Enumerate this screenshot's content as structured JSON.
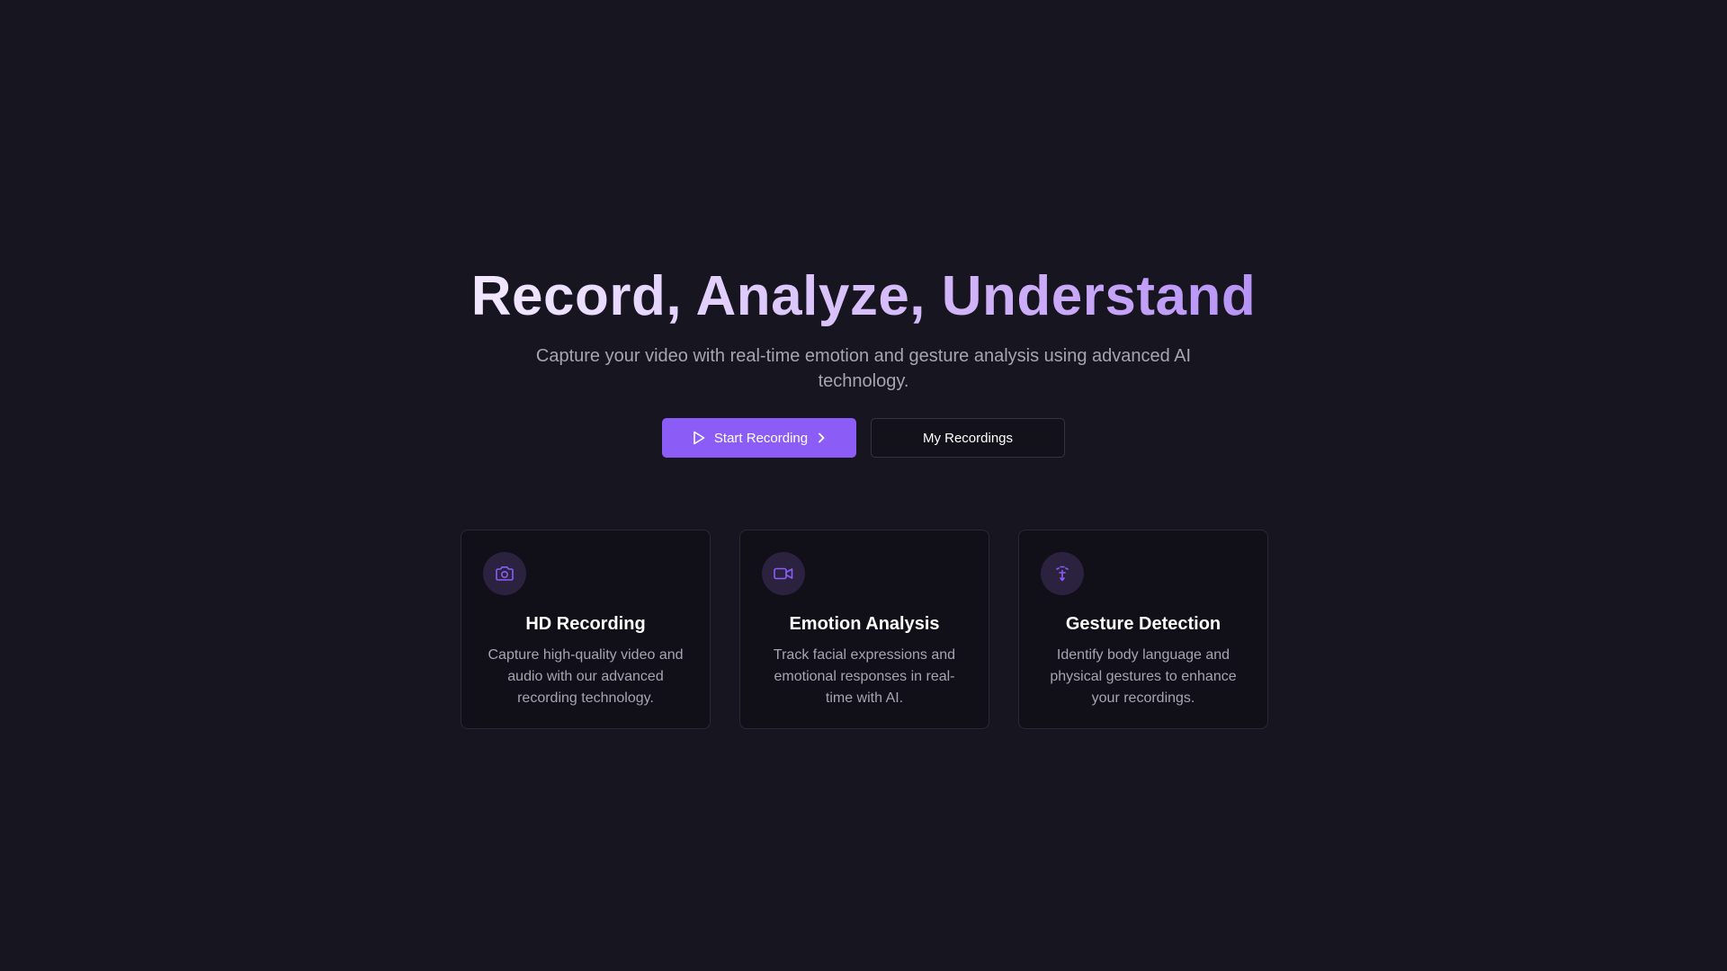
{
  "hero": {
    "title": "Record, Analyze, Understand",
    "subtitle": "Capture your video with real-time emotion and gesture analysis using advanced AI technology."
  },
  "actions": {
    "start_label": "Start Recording",
    "recordings_label": "My Recordings"
  },
  "features": [
    {
      "icon": "camera-icon",
      "title": "HD Recording",
      "description": "Capture high-quality video and audio with our advanced recording technology."
    },
    {
      "icon": "video-icon",
      "title": "Emotion Analysis",
      "description": "Track facial expressions and emotional responses in real-time with AI."
    },
    {
      "icon": "gesture-icon",
      "title": "Gesture Detection",
      "description": "Identify body language and physical gestures to enhance your recordings."
    }
  ],
  "colors": {
    "background": "#17151f",
    "accent": "#8b5cf6",
    "card_background": "#110f17",
    "muted_text": "#a7a4b3"
  }
}
